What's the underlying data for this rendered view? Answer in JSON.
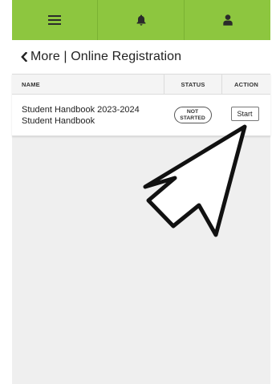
{
  "nav": {
    "tabs": [
      {
        "icon": "menu-icon"
      },
      {
        "icon": "bell-icon"
      },
      {
        "icon": "user-icon"
      }
    ]
  },
  "header": {
    "back_icon": "chevron-left-icon",
    "title": "More | Online Registration"
  },
  "table": {
    "columns": [
      "NAME",
      "STATUS",
      "ACTION"
    ],
    "rows": [
      {
        "name_line1": "Student Handbook 2023-2024",
        "name_line2": "Student Handbook",
        "status_line1": "NOT",
        "status_line2": "STARTED",
        "action": "Start"
      }
    ]
  },
  "colors": {
    "topbar": "#8dc63f",
    "background": "#efefef"
  },
  "overlay": {
    "icon": "arrow-cursor-icon"
  }
}
